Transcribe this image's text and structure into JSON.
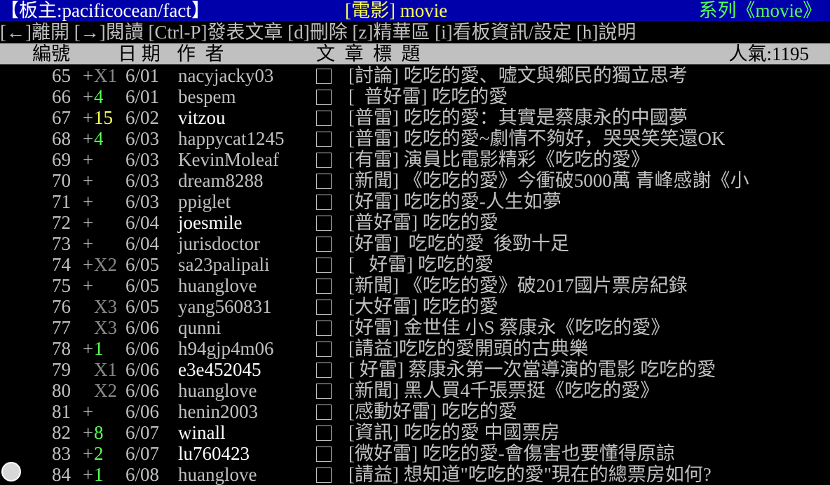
{
  "titlebar": {
    "board": "【板主:pacificocean/fact】",
    "center": "[電影] movie",
    "series": "系列《movie》",
    "colors": {
      "bg": "#0000aa",
      "board": "#ffffff",
      "center": "#ffff55",
      "series": "#55ff55"
    }
  },
  "help": {
    "text": "[←]離開 [→]閱讀 [Ctrl-P]發表文章 [d]刪除 [z]精華區 [i]看板資訊/設定 [h]說明"
  },
  "header": {
    "num": "編號",
    "date": "日 期",
    "author": "作  者",
    "title": "文  章  標  題",
    "popularity": "人氣:1195"
  },
  "posts": [
    {
      "num": "65",
      "mark": "+",
      "push": "X1",
      "push_color": "gray",
      "date": "6/01",
      "author": "nacyjacky03",
      "bright": false,
      "title": "[討論] 吃吃的愛、嘘文與鄉民的獨立思考"
    },
    {
      "num": "66",
      "mark": "+",
      "push": "4",
      "push_color": "green",
      "date": "6/01",
      "author": "bespem",
      "bright": false,
      "title": "[  普好雷] 吃吃的愛"
    },
    {
      "num": "67",
      "mark": "+",
      "push": "15",
      "push_color": "yellow",
      "date": "6/02",
      "author": "vitzou",
      "bright": true,
      "title": "[普雷] 吃吃的愛：其實是蔡康永的中國夢"
    },
    {
      "num": "68",
      "mark": "+",
      "push": "4",
      "push_color": "green",
      "date": "6/03",
      "author": "happycat1245",
      "bright": false,
      "title": "[普雷] 吃吃的愛~劇情不夠好，哭哭笑笑還OK"
    },
    {
      "num": "69",
      "mark": "+",
      "push": "",
      "push_color": "gray",
      "date": "6/03",
      "author": "KevinMoleaf",
      "bright": false,
      "title": "[有雷] 演員比電影精彩《吃吃的愛》"
    },
    {
      "num": "70",
      "mark": "+",
      "push": "",
      "push_color": "gray",
      "date": "6/03",
      "author": "dream8288",
      "bright": false,
      "title": "[新聞] 《吃吃的愛》今衝破5000萬 青峰感謝《小"
    },
    {
      "num": "71",
      "mark": "+",
      "push": "",
      "push_color": "gray",
      "date": "6/03",
      "author": "ppiglet",
      "bright": false,
      "title": "[好雷] 吃吃的愛-人生如夢"
    },
    {
      "num": "72",
      "mark": "+",
      "push": "",
      "push_color": "gray",
      "date": "6/04",
      "author": "joesmile",
      "bright": true,
      "title": "[普好雷] 吃吃的愛"
    },
    {
      "num": "73",
      "mark": "+",
      "push": "",
      "push_color": "gray",
      "date": "6/04",
      "author": "jurisdoctor",
      "bright": false,
      "title": "[好雷]  吃吃的愛  後勁十足"
    },
    {
      "num": "74",
      "mark": "+",
      "push": "X2",
      "push_color": "gray",
      "date": "6/05",
      "author": "sa23palipali",
      "bright": false,
      "title": "[   好雷] 吃吃的愛"
    },
    {
      "num": "75",
      "mark": "+",
      "push": "",
      "push_color": "gray",
      "date": "6/05",
      "author": "huanglove",
      "bright": false,
      "title": "[新聞] 《吃吃的愛》破2017國片票房紀錄"
    },
    {
      "num": "76",
      "mark": " ",
      "push": "X3",
      "push_color": "gray",
      "date": "6/05",
      "author": "yang560831",
      "bright": false,
      "title": "[大好雷] 吃吃的愛"
    },
    {
      "num": "77",
      "mark": " ",
      "push": "X3",
      "push_color": "gray",
      "date": "6/06",
      "author": "qunni",
      "bright": false,
      "title": "[好雷] 金世佳 小S 蔡康永《吃吃的愛》"
    },
    {
      "num": "78",
      "mark": "+",
      "push": "1",
      "push_color": "green",
      "date": "6/06",
      "author": "h94gjp4m06",
      "bright": false,
      "title": "[請益]吃吃的愛開頭的古典樂"
    },
    {
      "num": "79",
      "mark": " ",
      "push": "X1",
      "push_color": "gray",
      "date": "6/06",
      "author": "e3e452045",
      "bright": true,
      "title": "[ 好雷] 蔡康永第一次當導演的電影 吃吃的愛"
    },
    {
      "num": "80",
      "mark": " ",
      "push": "X2",
      "push_color": "gray",
      "date": "6/06",
      "author": "huanglove",
      "bright": false,
      "title": "[新聞] 黑人買4千張票挺《吃吃的愛》"
    },
    {
      "num": "81",
      "mark": "+",
      "push": "",
      "push_color": "gray",
      "date": "6/06",
      "author": "henin2003",
      "bright": false,
      "title": "[感動好雷] 吃吃的愛"
    },
    {
      "num": "82",
      "mark": "+",
      "push": "8",
      "push_color": "green",
      "date": "6/07",
      "author": "winall",
      "bright": true,
      "title": "[資訊] 吃吃的愛 中國票房"
    },
    {
      "num": "83",
      "mark": "+",
      "push": "2",
      "push_color": "green",
      "date": "6/07",
      "author": "lu760423",
      "bright": true,
      "title": "[微好雷] 吃吃的愛-會傷害也要懂得原諒"
    },
    {
      "num": "84",
      "mark": "+",
      "push": "1",
      "push_color": "green",
      "date": "6/08",
      "author": "huanglove",
      "bright": false,
      "title": "[請益] 想知道\"吃吃的愛\"現在的總票房如何?"
    }
  ]
}
